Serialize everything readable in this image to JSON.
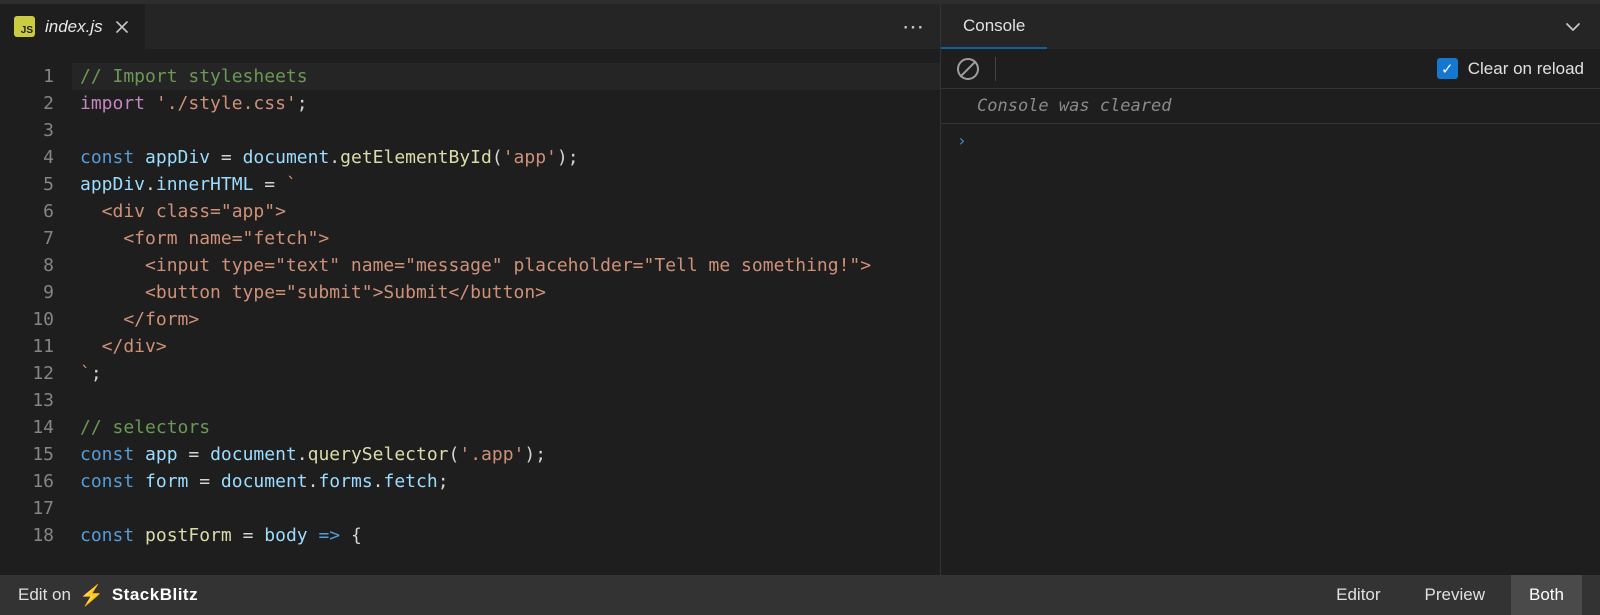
{
  "tabs": {
    "filename": "index.js",
    "badge": "JS"
  },
  "editor": {
    "lines": [
      {
        "no": 1,
        "tokens": [
          [
            "comment",
            "// Import stylesheets"
          ]
        ]
      },
      {
        "no": 2,
        "tokens": [
          [
            "keyword",
            "import"
          ],
          [
            "punct",
            " "
          ],
          [
            "string",
            "'./style.css'"
          ],
          [
            "punct",
            ";"
          ]
        ]
      },
      {
        "no": 3,
        "tokens": []
      },
      {
        "no": 4,
        "tokens": [
          [
            "storage",
            "const"
          ],
          [
            "punct",
            " "
          ],
          [
            "var",
            "appDiv"
          ],
          [
            "punct",
            " "
          ],
          [
            "op",
            "="
          ],
          [
            "punct",
            " "
          ],
          [
            "var",
            "document"
          ],
          [
            "punct",
            "."
          ],
          [
            "func",
            "getElementById"
          ],
          [
            "punct",
            "("
          ],
          [
            "string",
            "'app'"
          ],
          [
            "punct",
            ");"
          ]
        ]
      },
      {
        "no": 5,
        "tokens": [
          [
            "var",
            "appDiv"
          ],
          [
            "punct",
            "."
          ],
          [
            "var",
            "innerHTML"
          ],
          [
            "punct",
            " "
          ],
          [
            "op",
            "="
          ],
          [
            "punct",
            " "
          ],
          [
            "string",
            "`"
          ]
        ]
      },
      {
        "no": 6,
        "tokens": [
          [
            "string",
            "  <div class=\"app\">"
          ]
        ]
      },
      {
        "no": 7,
        "tokens": [
          [
            "string",
            "    <form name=\"fetch\">"
          ]
        ]
      },
      {
        "no": 8,
        "tokens": [
          [
            "string",
            "      <input type=\"text\" name=\"message\" placeholder=\"Tell me something!\">"
          ]
        ]
      },
      {
        "no": 9,
        "tokens": [
          [
            "string",
            "      <button type=\"submit\">Submit</button>"
          ]
        ]
      },
      {
        "no": 10,
        "tokens": [
          [
            "string",
            "    </form>"
          ]
        ]
      },
      {
        "no": 11,
        "tokens": [
          [
            "string",
            "  </div>"
          ]
        ]
      },
      {
        "no": 12,
        "tokens": [
          [
            "string",
            "`"
          ],
          [
            "punct",
            ";"
          ]
        ]
      },
      {
        "no": 13,
        "tokens": []
      },
      {
        "no": 14,
        "tokens": [
          [
            "comment",
            "// selectors"
          ]
        ]
      },
      {
        "no": 15,
        "tokens": [
          [
            "storage",
            "const"
          ],
          [
            "punct",
            " "
          ],
          [
            "var",
            "app"
          ],
          [
            "punct",
            " "
          ],
          [
            "op",
            "="
          ],
          [
            "punct",
            " "
          ],
          [
            "var",
            "document"
          ],
          [
            "punct",
            "."
          ],
          [
            "func",
            "querySelector"
          ],
          [
            "punct",
            "("
          ],
          [
            "string",
            "'.app'"
          ],
          [
            "punct",
            ");"
          ]
        ]
      },
      {
        "no": 16,
        "tokens": [
          [
            "storage",
            "const"
          ],
          [
            "punct",
            " "
          ],
          [
            "var",
            "form"
          ],
          [
            "punct",
            " "
          ],
          [
            "op",
            "="
          ],
          [
            "punct",
            " "
          ],
          [
            "var",
            "document"
          ],
          [
            "punct",
            "."
          ],
          [
            "var",
            "forms"
          ],
          [
            "punct",
            "."
          ],
          [
            "var",
            "fetch"
          ],
          [
            "punct",
            ";"
          ]
        ]
      },
      {
        "no": 17,
        "tokens": []
      },
      {
        "no": 18,
        "tokens": [
          [
            "storage",
            "const"
          ],
          [
            "punct",
            " "
          ],
          [
            "func",
            "postForm"
          ],
          [
            "punct",
            " "
          ],
          [
            "op",
            "="
          ],
          [
            "punct",
            " "
          ],
          [
            "var",
            "body"
          ],
          [
            "punct",
            " "
          ],
          [
            "storage",
            "=>"
          ],
          [
            "punct",
            " {"
          ]
        ]
      }
    ]
  },
  "console": {
    "tab_label": "Console",
    "clear_on_reload_label": "Clear on reload",
    "message": "Console was cleared",
    "prompt": "›"
  },
  "footer": {
    "edit_on": "Edit on",
    "brand": "StackBlitz",
    "editor": "Editor",
    "preview": "Preview",
    "both": "Both"
  }
}
